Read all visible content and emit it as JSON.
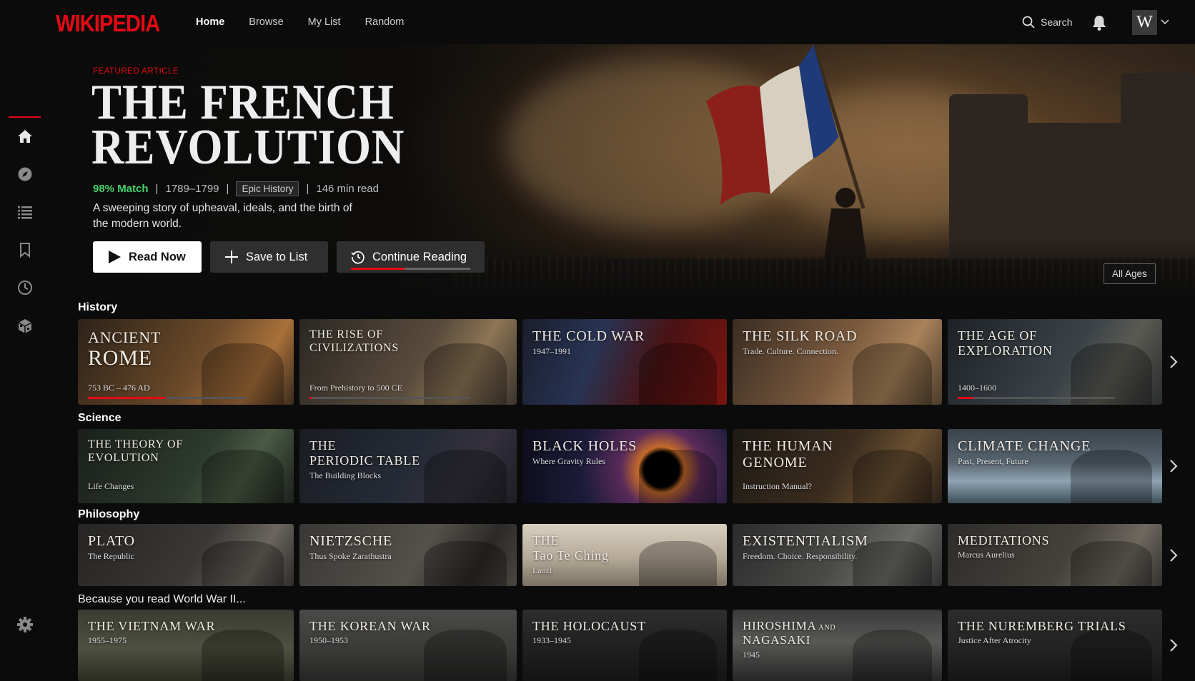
{
  "brand": {
    "logo": "WIKIPEDIA",
    "accent": "#e50914"
  },
  "nav": {
    "items": [
      "Home",
      "Browse",
      "My List",
      "Random"
    ],
    "active": "Home"
  },
  "header": {
    "search_label": "Search",
    "avatar_letter": "W"
  },
  "sidebar": {
    "icons": [
      "home-icon",
      "compass-icon",
      "list-icon",
      "bookmark-icon",
      "history-icon",
      "cube-icon",
      "settings-icon"
    ],
    "active": "home-icon"
  },
  "hero": {
    "label": "FEATURED ARTICLE",
    "title_line1": "THE FRENCH",
    "title_line2": "REVOLUTION",
    "match": "98% Match",
    "years": "1789–1799",
    "tag": "Epic History",
    "read_time": "146 min read",
    "sep": "|",
    "description": "A sweeping story of upheaval, ideals, and the birth of the modern world.",
    "buttons": {
      "read": "Read Now",
      "save": "Save to List",
      "continue": "Continue Reading"
    },
    "continue_progress": 0.45,
    "age_rating": "All Ages"
  },
  "rows": [
    {
      "title": "History",
      "cards": [
        {
          "line1": "ANCIENT",
          "line2": "ROME",
          "sub": "753 BC – 476 AD",
          "progress": 0.49
        },
        {
          "line1": "THE RISE OF",
          "line2": "CIVILIZATIONS",
          "sub": "From Prehistory to 500 CE",
          "progress": 0.02
        },
        {
          "line1": "THE COLD WAR",
          "line2": "",
          "sub": "1947–1991"
        },
        {
          "line1": "THE SILK ROAD",
          "line2": "",
          "sub": "Trade. Culture. Connection."
        },
        {
          "line1": "THE AGE OF",
          "line2": "EXPLORATION",
          "sub": "1400–1600",
          "progress": 0.1
        }
      ]
    },
    {
      "title": "Science",
      "cards": [
        {
          "line1": "THE THEORY OF",
          "line2": "EVOLUTION",
          "sub": "Life Changes"
        },
        {
          "line1": "THE",
          "line2": "PERIODIC TABLE",
          "sub": "The Building Blocks"
        },
        {
          "line1": "BLACK HOLES",
          "line2": "",
          "sub": "Where Gravity Rules"
        },
        {
          "line1": "THE HUMAN",
          "line2": "GENOME",
          "sub": "Instruction Manual?"
        },
        {
          "line1": "CLIMATE CHANGE",
          "line2": "",
          "sub": "Past, Present, Future"
        }
      ]
    },
    {
      "title": "Philosophy",
      "cards": [
        {
          "line1": "PLATO",
          "line2": "",
          "sub": "The Republic"
        },
        {
          "line1": "NIETZSCHE",
          "line2": "",
          "sub": "Thus Spoke Zarathustra"
        },
        {
          "line1": "THE",
          "line2": "Tao Te Ching",
          "sub": "Laozi"
        },
        {
          "line1": "EXISTENTIALISM",
          "line2": "",
          "sub": "Freedom. Choice. Responsibility."
        },
        {
          "line1": "MEDITATIONS",
          "line2": "",
          "sub": "Marcus Aurelius"
        }
      ]
    },
    {
      "title": "Because you read World War II...",
      "cards": [
        {
          "line1": "THE VIETNAM WAR",
          "line2": "",
          "sub": "1955–1975"
        },
        {
          "line1": "THE KOREAN WAR",
          "line2": "",
          "sub": "1950–1953"
        },
        {
          "line1": "THE HOLOCAUST",
          "line2": "",
          "sub": "1933–1945"
        },
        {
          "line1": "HIROSHIMA",
          "line1_small": "AND",
          "line2": "NAGASAKI",
          "sub": "1945"
        },
        {
          "line1": "THE NUREMBERG TRIALS",
          "line2": "",
          "sub": "Justice After Atrocity"
        }
      ]
    }
  ]
}
